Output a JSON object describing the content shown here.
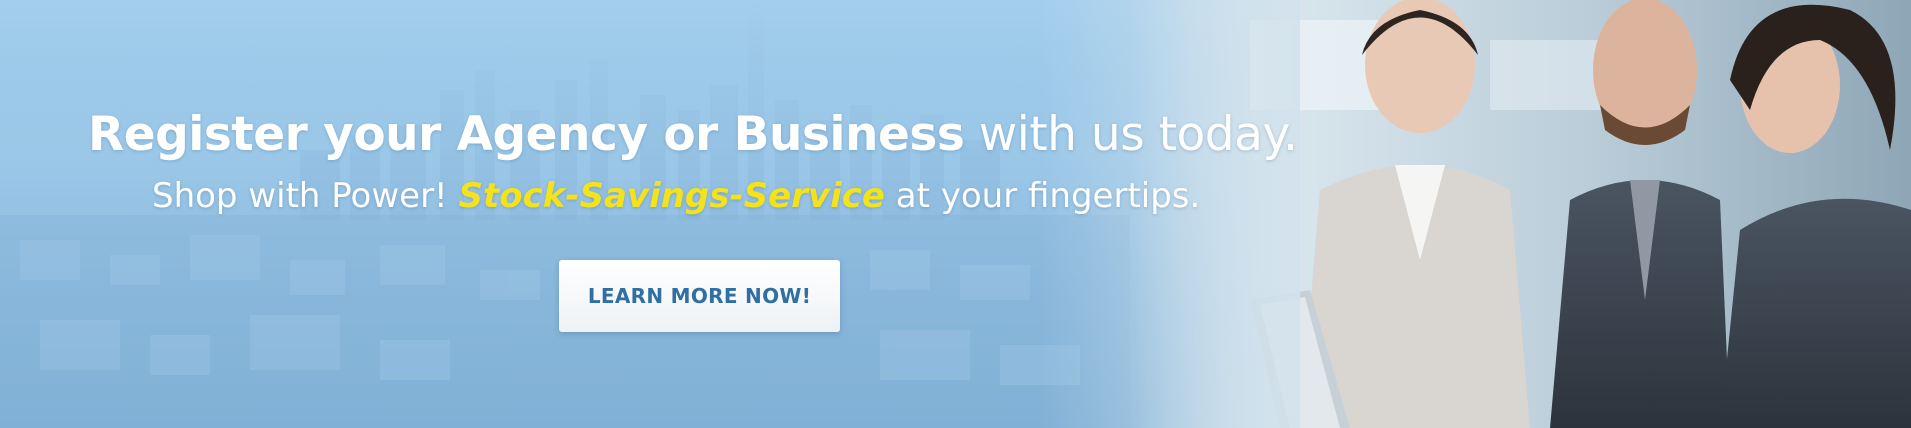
{
  "banner": {
    "headline_strong": "Register your Agency or Business",
    "headline_rest": " with us today.",
    "subline_lead": "Shop with Power! ",
    "subline_accent": "Stock-Savings-Service",
    "subline_tail": " at your fingertips.",
    "cta_label": "LEARN MORE NOW!",
    "colors": {
      "background": "#9fcbea",
      "text": "#ffffff",
      "accent": "#f4e21b",
      "cta_text": "#2f6fa3"
    }
  }
}
